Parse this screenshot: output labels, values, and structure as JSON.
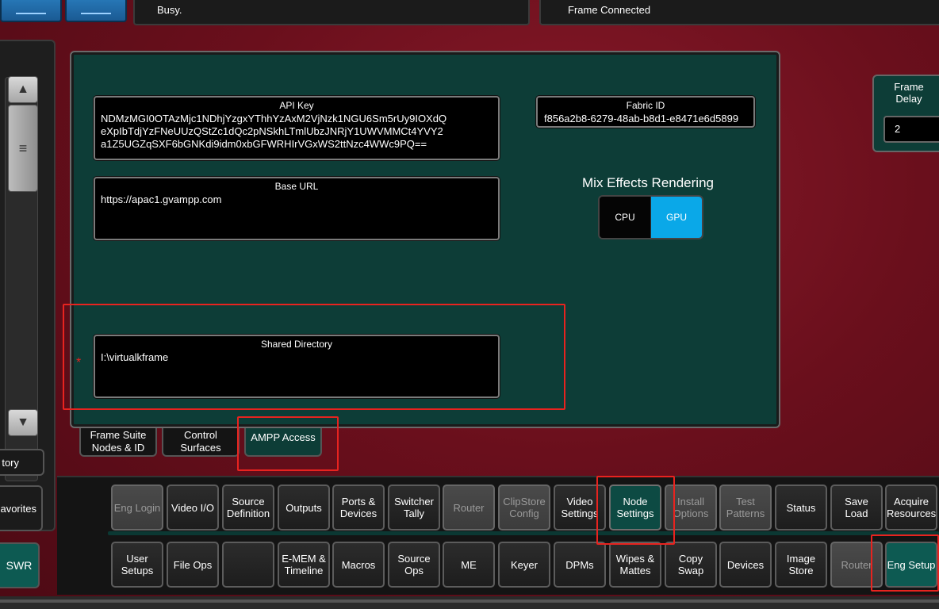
{
  "status": {
    "busy_text": "Busy.",
    "frame_text": "Frame Connected"
  },
  "left": {
    "history_label": "tory",
    "favorites_label": "Favorites",
    "swr_label": "SWR",
    "scroll_up_icon": "▲",
    "scroll_down_icon": "▼",
    "scroll_thumb_icon": "≡"
  },
  "fields": {
    "api_key": {
      "title": "API Key",
      "value": "NDMzMGI0OTAzMjc1NDhjYzgxYThhYzAxM2VjNzk1NGU6Sm5rUy9IOXdQ\neXpIbTdjYzFNeUUzQStZc1dQc2pNSkhLTmlUbzJNRjY1UWVMMCt4YVY2\na1Z5UGZqSXF6bGNKdi9idm0xbGFWRHIrVGxWS2ttNzc4WWc9PQ=="
    },
    "base_url": {
      "title": "Base URL",
      "value": "https://apac1.gvampp.com"
    },
    "shared_directory": {
      "title": "Shared Directory",
      "value": "I:\\virtualkframe",
      "required_marker": "*"
    },
    "fabric_id": {
      "title": "Fabric ID",
      "value": "f856a2b8-6279-48ab-b8d1-e8471e6d5899"
    }
  },
  "mix_effects": {
    "title": "Mix Effects Rendering",
    "options": [
      "CPU",
      "GPU"
    ],
    "selected": "GPU"
  },
  "frame_delay": {
    "label": "Frame Delay",
    "value": "2"
  },
  "subtabs": [
    {
      "label": "Frame Suite Nodes & ID"
    },
    {
      "label": "Control Surfaces"
    },
    {
      "label": "AMPP Access"
    }
  ],
  "nav_row1": [
    "Eng Login",
    "Video I/O",
    "Source Definition",
    "Outputs",
    "Ports & Devices",
    "Switcher Tally",
    "Router",
    "ClipStore Config",
    "Video Settings",
    "Node Settings",
    "Install Options",
    "Test Patterns",
    "Status",
    "Save Load",
    "Acquire Resources"
  ],
  "nav_row2": [
    "User Setups",
    "File Ops",
    "",
    "E-MEM & Timeline",
    "Macros",
    "Source Ops",
    "ME",
    "Keyer",
    "DPMs",
    "Wipes & Mattes",
    "Copy Swap",
    "Devices",
    "Image Store",
    "Router",
    "Eng Setup"
  ]
}
